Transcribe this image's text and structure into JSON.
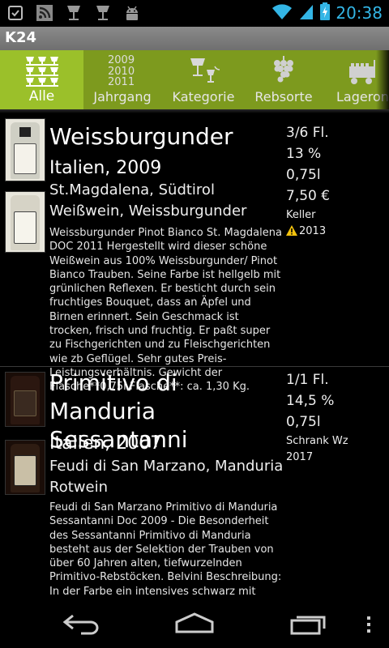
{
  "status_bar": {
    "time": "20:38",
    "icons": [
      "debug-icon",
      "rss-icon",
      "glass-icon",
      "glass-icon",
      "android-icon",
      "wifi-icon",
      "signal-icon",
      "battery-charging-icon"
    ]
  },
  "app": {
    "title": "K24"
  },
  "tabs": [
    {
      "label": "Alle",
      "icon": "all-glasses-icon",
      "active": true
    },
    {
      "label": "Jahrgang",
      "icon_text": [
        "2009",
        "2010",
        "2011"
      ],
      "active": false
    },
    {
      "label": "Kategorie",
      "icon": "glasses-bottle-icon",
      "active": false
    },
    {
      "label": "Rebsorte",
      "icon": "grapes-icon",
      "active": false
    },
    {
      "label": "Lageron",
      "icon": "storage-cart-icon",
      "active": false
    }
  ],
  "wines": [
    {
      "name": "Weissburgunder",
      "origin": "Italien, 2009",
      "producer": "St.Magdalena, Südtirol",
      "type": "Weißwein, Weissburgunder",
      "description": "Weissburgunder Pinot Bianco St. Magdalena DOC 2011 Hergestellt wird dieser schöne Weißwein aus 100% Weissburgunder/ Pinot Bianco Trauben. Seine Farbe ist hellgelb mit grünlichen Reflexen. Er besticht durch sein fruchtiges Bouquet, dass an Äpfel und Birnen erinnert. Sein Geschmack ist trocken, frisch und fruchtig. Er paßt super zu Fischgerichten und zu Fleischgerichten wie zb Geflügel. Sehr gutes Preis-Leistungsverhältnis. Gewicht der Flasche**0,75l Flasche**: ca. 1,30 Kg.",
      "bottles": "3/6 Fl.",
      "alcohol": "13 %",
      "volume": "0,75l",
      "price": "7,50 €",
      "location": "Keller",
      "drink_until": "2013"
    },
    {
      "name": "Primitivo di Manduria Sessantanni",
      "origin": "Italien, 2007",
      "producer": "Feudi di San Marzano, Manduria",
      "type": "Rotwein",
      "description": "Feudi di San Marzano Primitivo di Manduria Sessantanni Doc 2009 - Die Besonderheit des Sessantanni Primitivo di Manduria besteht aus der Selektion der Trauben von über 60 Jahren alten, tiefwurzelnden Primitivo-Rebstöcken. Belvini Beschreibung: In der Farbe ein intensives schwarz mit leuchtendem rubinroten Kern. Die Nase mit komplexem",
      "bottles": "1/1 Fl.",
      "alcohol": "14,5 %",
      "volume": "0,75l",
      "location": "Schrank Wz",
      "drink_until": "2017"
    }
  ],
  "nav": {
    "buttons": [
      "back-icon",
      "home-icon",
      "recent-apps-icon",
      "overflow-menu-icon"
    ]
  },
  "colors": {
    "tab_bar": "#7d9a1e",
    "tab_active": "#9bc02a",
    "clock": "#33b5e5",
    "warning": "#f4c20d"
  }
}
